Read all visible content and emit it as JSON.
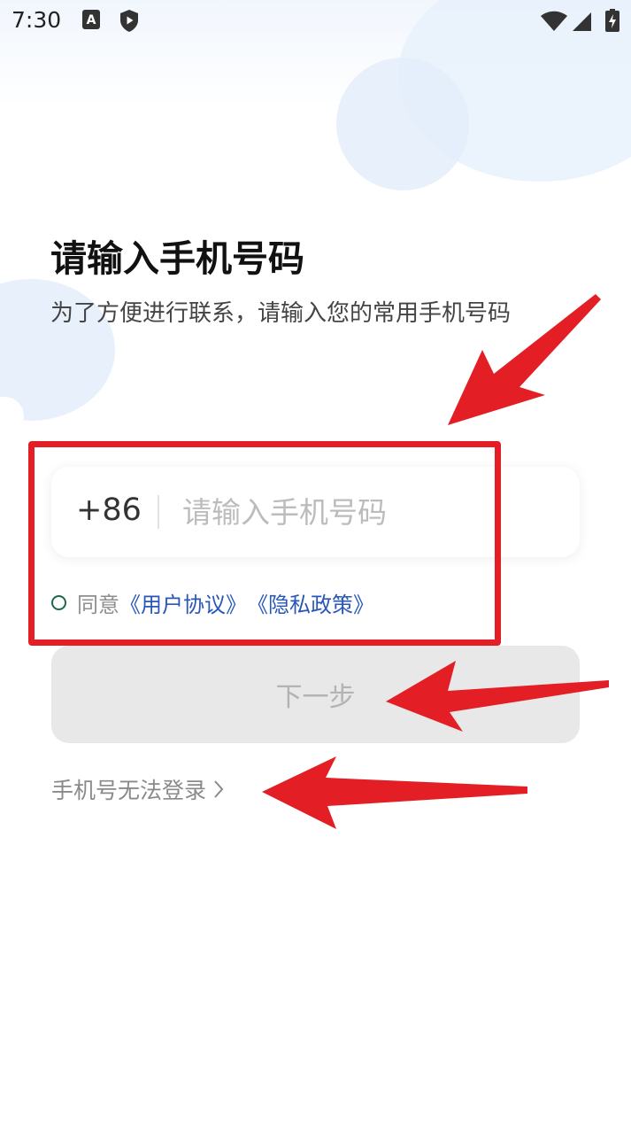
{
  "status_bar": {
    "time": "7:30",
    "notification_icons": [
      "a-icon",
      "shield-play-icon"
    ],
    "system_icons": [
      "wifi-icon",
      "signal-icon",
      "battery-charging-icon"
    ]
  },
  "page": {
    "title": "请输入手机号码",
    "subtitle": "为了方便进行联系，请输入您的常用手机号码"
  },
  "phone_form": {
    "country_code": "+86",
    "input_value": "",
    "input_placeholder": "请输入手机号码"
  },
  "agreement": {
    "prefix": "同意",
    "user_agreement": "《用户协议》",
    "privacy_policy": "《隐私政策》",
    "checked": false
  },
  "next_button": {
    "label": "下一步",
    "enabled": false
  },
  "help_link": {
    "label": "手机号无法登录"
  },
  "annotations": {
    "color": "#e31e24"
  },
  "colors": {
    "link": "#2857b8",
    "radio_border": "#22664a",
    "button_disabled_bg": "#e8e8e8",
    "button_disabled_text": "#b3b3b3"
  }
}
